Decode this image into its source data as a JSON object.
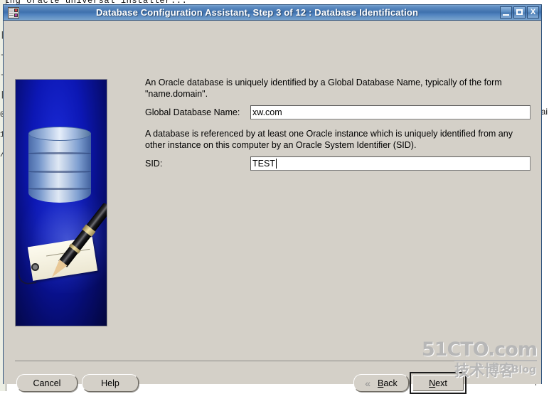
{
  "desktop": {
    "background_text_top": "ing oracle universal installer...",
    "background_text_right": "ai",
    "background_left_glyphs": "|\n-\n-\n|\n0\n1\n/"
  },
  "window": {
    "title": "Database Configuration Assistant, Step 3 of 12 : Database Identification",
    "icon": "database-assistant-icon",
    "controls": {
      "minimize": "minimize-icon",
      "maximize": "maximize-icon",
      "close": "X"
    }
  },
  "content": {
    "graphic_alt": "database-pen-tag-graphic",
    "intro_paragraph_1": "An Oracle database is uniquely identified by a Global Database Name, typically of the form \"name.domain\".",
    "global_db_name": {
      "label": "Global Database Name:",
      "value": "xw.com",
      "placeholder": ""
    },
    "intro_paragraph_2": "A database is referenced by at least one Oracle instance which is uniquely identified from any other instance on this computer by an Oracle System Identifier (SID).",
    "sid": {
      "label": "SID:",
      "value": "TEST",
      "placeholder": ""
    }
  },
  "footer": {
    "cancel_label": "Cancel",
    "help_label": "Help",
    "back_label": "Back",
    "back_mnemonic": "B",
    "back_rest": "ack",
    "next_label": "Next",
    "next_mnemonic": "N",
    "next_rest": "ext",
    "back_chevron": "«"
  },
  "watermark": {
    "line1": "51CTO.com",
    "line2": "技术博客",
    "line3": "Blog"
  },
  "colors": {
    "title_bar_blue": "#3f71ad",
    "dialog_face": "#d4d0c8",
    "graphic_blue": "#0c17b4",
    "watermark_grey": "#b7b7b7"
  }
}
